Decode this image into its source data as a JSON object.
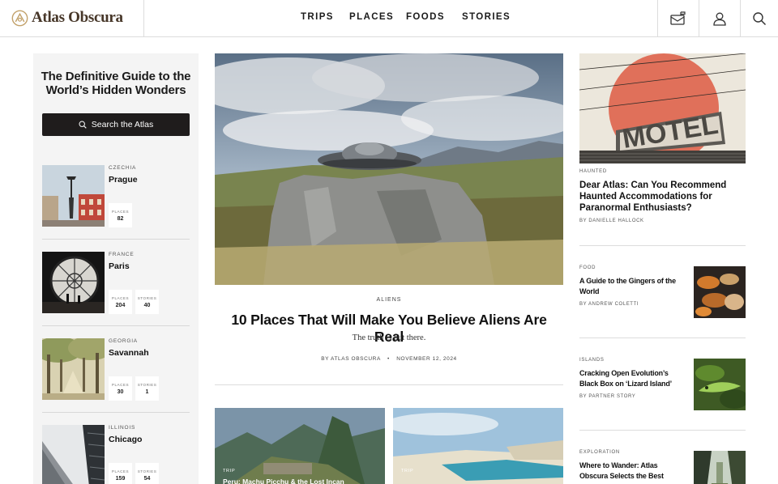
{
  "header": {
    "logo_text": "Atlas Obscura",
    "nav": [
      "TRIPS",
      "PLACES",
      "FOODS",
      "STORIES"
    ],
    "icons": [
      "mailbox-icon",
      "user-icon",
      "search-icon"
    ],
    "brand_color": "#c2a16a"
  },
  "sidebar": {
    "title": "The Definitive Guide to the World’s Hidden Wonders",
    "search_label": "Search the Atlas",
    "destinations": [
      {
        "country": "CZECHIA",
        "city": "Prague",
        "places_label": "PLACES",
        "places": "82",
        "stories_label": "",
        "stories": ""
      },
      {
        "country": "FRANCE",
        "city": "Paris",
        "places_label": "PLACES",
        "places": "204",
        "stories_label": "STORIES",
        "stories": "40"
      },
      {
        "country": "GEORGIA",
        "city": "Savannah",
        "places_label": "PLACES",
        "places": "30",
        "stories_label": "STORIES",
        "stories": "1"
      },
      {
        "country": "ILLINOIS",
        "city": "Chicago",
        "places_label": "PLACES",
        "places": "159",
        "stories_label": "STORIES",
        "stories": "54"
      }
    ]
  },
  "hero": {
    "category": "ALIENS",
    "title": "10 Places That Will Make You Believe Aliens Are Real",
    "subtitle": "The truth is out there.",
    "byline": "BY ATLAS OBSCURA",
    "date": "NOVEMBER 12, 2024"
  },
  "sub_cards": [
    {
      "category": "TRIP",
      "title": "Peru: Machu Picchu & the Lost Incan"
    },
    {
      "category": "TRIP",
      "title": ""
    }
  ],
  "right_column": {
    "feature": {
      "category": "HAUNTED",
      "title": "Dear Atlas: Can You Recommend Haunted Accommodations for Paranormal Enthusiasts?",
      "byline": "BY DANIELLE HALLOCK"
    },
    "articles": [
      {
        "category": "FOOD",
        "title": "A Guide to the Gingers of the World",
        "byline": "BY ANDREW COLETTI"
      },
      {
        "category": "ISLANDS",
        "title": "Cracking Open Evolution’s Black Box on ‘Lizard Island’",
        "byline": "BY PARTNER STORY"
      },
      {
        "category": "EXPLORATION",
        "title": "Where to Wander: Atlas Obscura Selects the Best",
        "byline": ""
      }
    ]
  }
}
